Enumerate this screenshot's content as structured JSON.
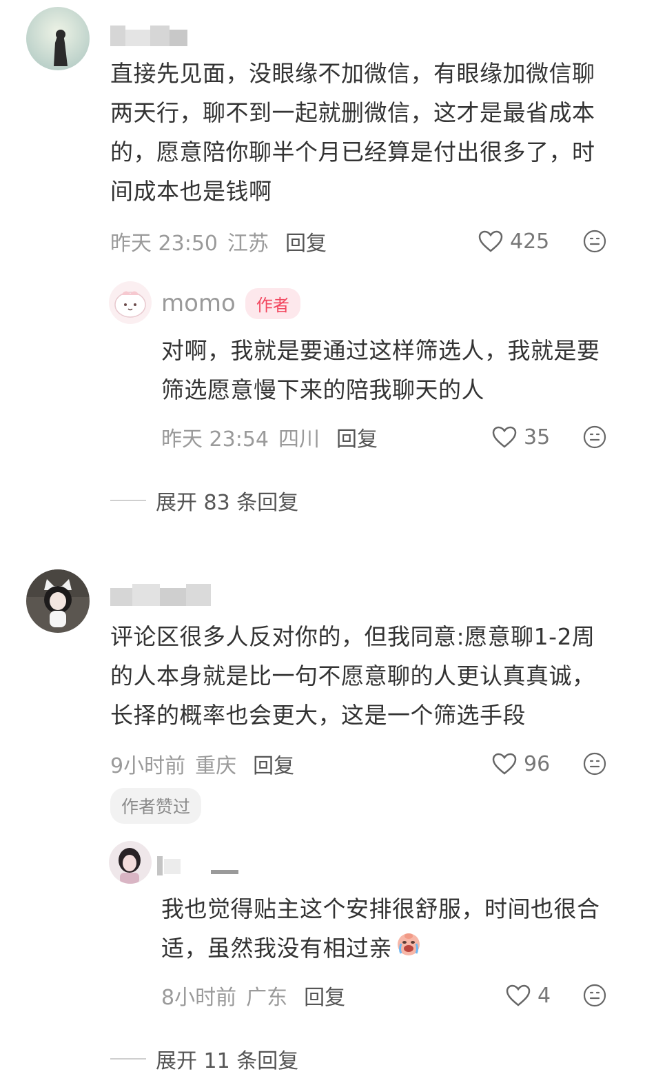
{
  "comments": [
    {
      "text": "直接先见面，没眼缘不加微信，有眼缘加微信聊两天行，聊不到一起就删微信，这才是最省成本的，愿意陪你聊半个月已经算是付出很多了，时间成本也是钱啊",
      "time": "昨天 23:50",
      "location": "江苏",
      "reply_label": "回复",
      "likes": "425",
      "reply": {
        "name": "momo",
        "badge": "作者",
        "text": "对啊，我就是要通过这样筛选人，我就是要筛选愿意慢下来的陪我聊天的人",
        "time": "昨天 23:54",
        "location": "四川",
        "reply_label": "回复",
        "likes": "35"
      },
      "expand_label": "展开 83 条回复"
    },
    {
      "text": "评论区很多人反对你的，但我同意:愿意聊1-2周的人本身就是比一句不愿意聊的人更认真真诚，长择的概率也会更大，这是一个筛选手段",
      "time": "9小时前",
      "location": "重庆",
      "reply_label": "回复",
      "likes": "96",
      "liked_tag": "作者赞过",
      "reply": {
        "text": "我也觉得贴主这个安排很舒服，时间也很合适，虽然我没有相过亲",
        "time": "8小时前",
        "location": "广东",
        "reply_label": "回复",
        "likes": "4"
      },
      "expand_label": "展开 11 条回复"
    }
  ],
  "icons": {
    "like": "heart-outline-icon",
    "emoji": "emoji-face-icon",
    "crying_emoji": "crying-face-emoji"
  },
  "colors": {
    "badge_bg": "#fde8ec",
    "badge_text": "#f2475f",
    "meta_text": "#9a9a9a",
    "body_text": "#333333"
  }
}
